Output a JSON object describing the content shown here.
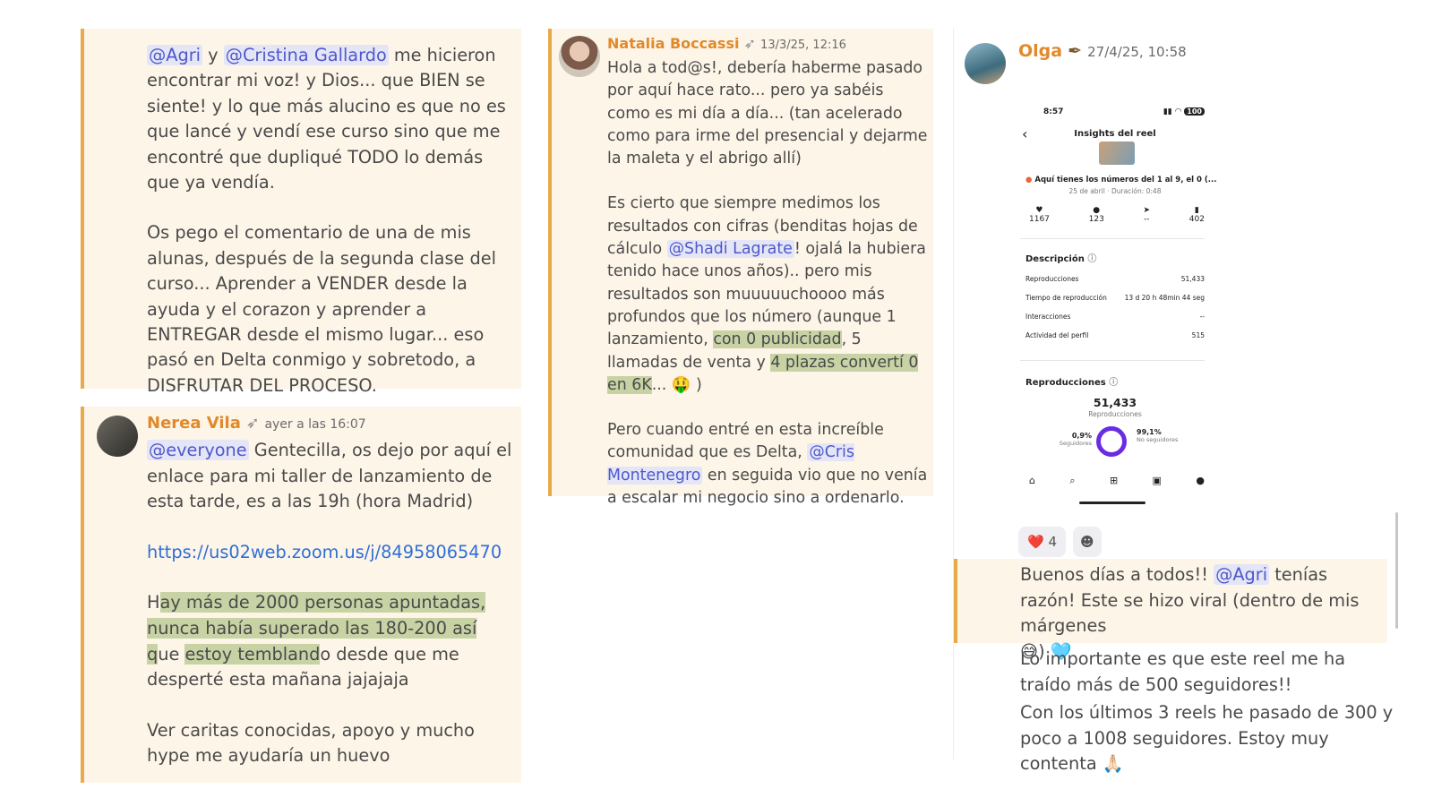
{
  "panel_a": {
    "p1": {
      "m1": "@Agri",
      "t1": " y ",
      "m2": "@Cristina Gallardo",
      "t2": " me hicieron encontrar mi voz! y Dios... que BIEN se siente! y lo que más alucino es que no es que lancé y vendí ese curso sino que me encontré que dupliqué TODO lo demás que ya vendía."
    },
    "p2": "Os pego el comentario de una de mis alunas, después de la segunda clase del curso... Aprender a VENDER desde la ayuda y el corazon y aprender a ENTREGAR desde el mismo lugar... eso pasó en Delta conmigo y sobretodo, a DISFRUTAR DEL PROCESO."
  },
  "panel_b": {
    "username": "Nerea Vila",
    "badge_icon": "bow-arrow-icon",
    "timestamp": "ayer a las 16:07",
    "mention": "@everyone",
    "intro": " Gentecilla, os dejo por aquí el enlace para mi taller de lanzamiento de esta tarde, es a las 19h (hora Madrid)",
    "link": "https://us02web.zoom.us/j/84958065470",
    "p3_lead": "H",
    "p3_marked": "ay más de 2000 personas apuntadas, nunca había superado las 180-200 así q",
    "p3_mid": "ue ",
    "p3_marked2": "estoy tembland",
    "p3_tail": "o desde que me desperté esta mañana jajajaja",
    "p4": "Ver caritas conocidas, apoyo y mucho hype me ayudaría un huevo"
  },
  "panel_c": {
    "username": "Natalia Boccassi",
    "badge_icon": "bow-arrow-icon",
    "timestamp": "13/3/25, 12:16",
    "p1": "Hola a tod@s!, debería haberme pasado por aquí hace rato... pero ya sabéis como es mi día a día... (tan acelerado como para irme del presencial y dejarme la maleta y el abrigo allí)",
    "p2_a": "Es cierto que siempre medimos los resultados con cifras (benditas hojas de cálculo ",
    "p2_mention": "@Shadi Lagrate",
    "p2_b": "! ojalá la hubiera tenido hace unos años).. pero mis resultados son muuuuuchoooo más profundos que los número (aunque 1 lanzamiento, ",
    "p2_mark1": "con 0 publicidad",
    "p2_c": ", 5 llamadas de venta y ",
    "p2_mark2": "4 plazas convertí 0 en 6K",
    "p2_d": "... 🤑 )",
    "p3_a": "Pero cuando entré en esta increíble comunidad que es Delta, ",
    "p3_mention": "@Cris Montenegro",
    "p3_b": " en seguida vio que no venía a escalar mi negocio sino a ordenarlo."
  },
  "panel_d": {
    "username": "Olga",
    "badge_icon": "feather-icon",
    "timestamp": "27/4/25, 10:58",
    "phone": {
      "time": "8:57",
      "battery": "100",
      "title": "Insights del reel",
      "reel_title": "Aquí tienes los números del 1 al 9, el 0 (...",
      "reel_meta": "25 de abril · Duración: 0:48",
      "stats": [
        "1167",
        "123",
        "--",
        "402"
      ],
      "desc_title": "Descripción",
      "rows": [
        {
          "label": "Reproducciones",
          "value": "51,433"
        },
        {
          "label": "Tiempo de reproducción",
          "value": "13 d 20 h 48min 44 seg"
        },
        {
          "label": "Interacciones",
          "value": "--"
        },
        {
          "label": "Actividad del perfil",
          "value": "515"
        }
      ],
      "repro_title": "Reproducciones",
      "repro_value": "51,433",
      "repro_label": "Reproducciones",
      "followers_pct": "0,9%",
      "followers_label": "Seguidores",
      "nonfollowers_pct": "99,1%",
      "nonfollowers_label": "No seguidores"
    },
    "reaction_emoji": "❤️",
    "reaction_count": "4",
    "reply_a": "Buenos días a todos!! ",
    "reply_mention": "@Agri",
    "reply_b": " tenías razón! Este se hizo viral (dentro de mis márgenes",
    "reply_emojis": "😅) 🩵",
    "msg2": "Lo importante es que este reel me ha traído más de 500 seguidores!!",
    "msg3": "Con los últimos 3 reels he pasado de 300 y poco a 1008 seguidores. Estoy muy contenta 🙏🏻"
  }
}
